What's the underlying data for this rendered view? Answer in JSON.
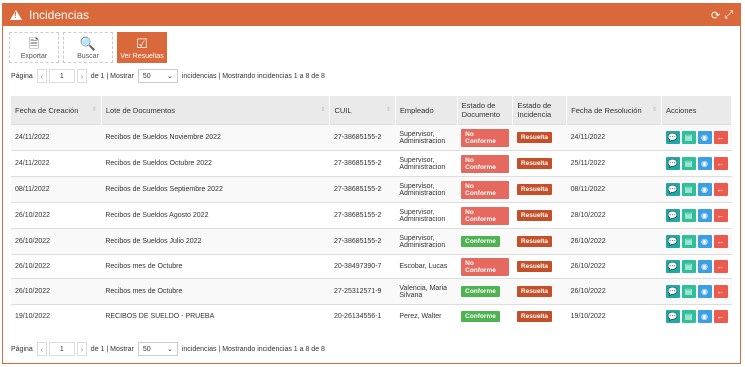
{
  "window": {
    "title": "Incidencias"
  },
  "toolbar": {
    "export_label": "Exportar",
    "search_label": "Buscar",
    "resolved_label": "Ver Resueltas"
  },
  "pager": {
    "page_label": "Página",
    "page_value": "1",
    "of_label": "de 1 | Mostrar",
    "page_size": "50",
    "summary": "incidencias | Mostrando incidencias 1 a 8 de 8"
  },
  "columns": [
    "Fecha de Creación",
    "Lote de Documentos",
    "CUIL",
    "Empleado",
    "Estado de Documento",
    "Estado de Incidencia",
    "Fecha de Resolución",
    "Acciones"
  ],
  "rows": [
    {
      "fecha": "24/11/2022",
      "lote": "Recibos de Sueldos Noviembre 2022",
      "cuil": "27-38685155-2",
      "empleado": "Supervisor, Administracion",
      "estado_doc": "No Conforme",
      "estado_inc": "Resuelta",
      "resolucion": "24/11/2022"
    },
    {
      "fecha": "24/11/2022",
      "lote": "Recibos de Sueldos Octubre 2022",
      "cuil": "27-38685155-2",
      "empleado": "Supervisor, Administracion",
      "estado_doc": "No Conforme",
      "estado_inc": "Resuelta",
      "resolucion": "25/11/2022"
    },
    {
      "fecha": "08/11/2022",
      "lote": "Recibos de Sueldos Septiembre 2022",
      "cuil": "27-38685155-2",
      "empleado": "Supervisor, Administracion",
      "estado_doc": "No Conforme",
      "estado_inc": "Resuelta",
      "resolucion": "08/11/2022"
    },
    {
      "fecha": "26/10/2022",
      "lote": "Recibos de Sueldos Agosto 2022",
      "cuil": "27-38685155-2",
      "empleado": "Supervisor, Administracion",
      "estado_doc": "No Conforme",
      "estado_inc": "Resuelta",
      "resolucion": "28/10/2022"
    },
    {
      "fecha": "26/10/2022",
      "lote": "Recibos de Sueldos Julio 2022",
      "cuil": "27-38685155-2",
      "empleado": "Supervisor, Administracion",
      "estado_doc": "Conforme",
      "estado_inc": "Resuelta",
      "resolucion": "26/10/2022"
    },
    {
      "fecha": "26/10/2022",
      "lote": "Recibos mes de Octubre",
      "cuil": "20-38497390-7",
      "empleado": "Escobar, Lucas",
      "estado_doc": "No Conforme",
      "estado_inc": "Resuelta",
      "resolucion": "26/10/2022"
    },
    {
      "fecha": "26/10/2022",
      "lote": "Recibos mes de Octubre",
      "cuil": "27-25312571-9",
      "empleado": "Valencia, Maria Silvana",
      "estado_doc": "Conforme",
      "estado_inc": "Resuelta",
      "resolucion": "26/10/2022"
    },
    {
      "fecha": "19/10/2022",
      "lote": "RECIBOS DE SUELDO - PRUEBA",
      "cuil": "20-26134556-1",
      "empleado": "Perez, Walter",
      "estado_doc": "Conforme",
      "estado_inc": "Resuelta",
      "resolucion": "19/10/2022"
    }
  ],
  "colors": {
    "accent": "#d9683a",
    "no_conforme": "#e5695e",
    "conforme": "#4fb352",
    "resuelta": "#c44f29"
  },
  "icons": [
    "warning-icon",
    "refresh-icon",
    "expand-icon",
    "excel-icon",
    "search-icon",
    "checkbox-icon",
    "comment-icon",
    "document-icon",
    "user-icon",
    "back-arrow-icon"
  ]
}
